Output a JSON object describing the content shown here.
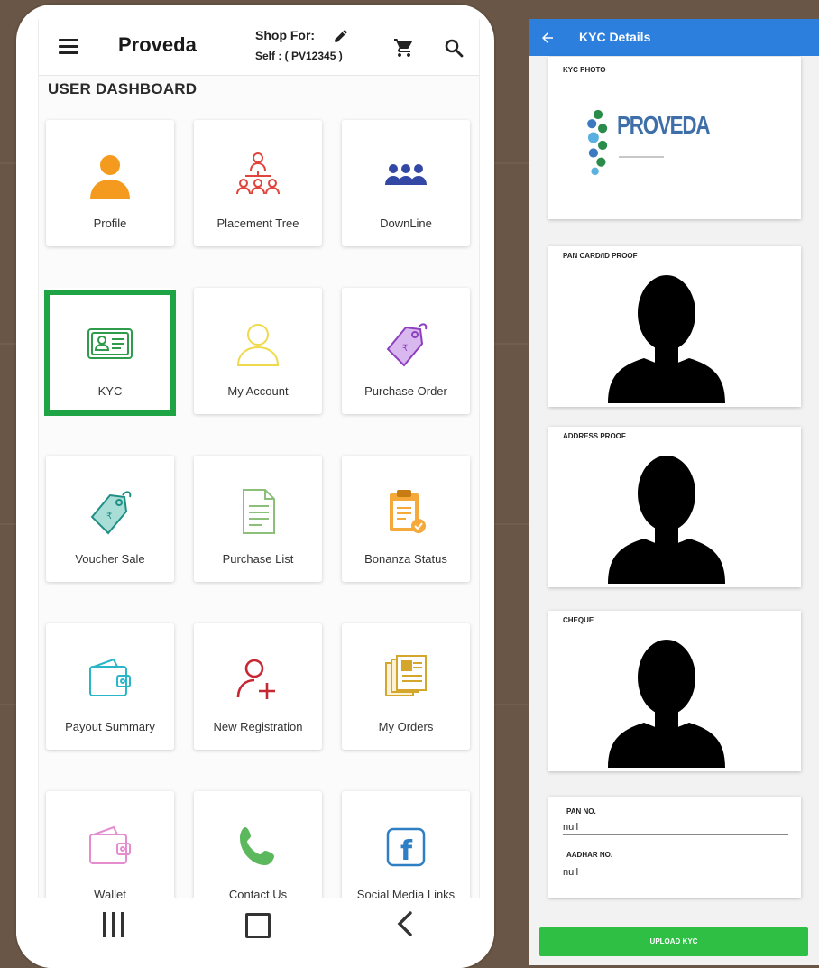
{
  "dashboard": {
    "app_name": "Proveda",
    "shop_for_label": "Shop For:",
    "shop_for_user": "Self : ( PV12345 )",
    "section_title": "USER DASHBOARD",
    "tiles": [
      {
        "label": "Profile",
        "icon": "profile-icon"
      },
      {
        "label": "Placement Tree",
        "icon": "placement-tree-icon"
      },
      {
        "label": "DownLine",
        "icon": "downline-icon"
      },
      {
        "label": "KYC",
        "icon": "kyc-card-icon",
        "selected": true
      },
      {
        "label": "My Account",
        "icon": "account-icon"
      },
      {
        "label": "Purchase Order",
        "icon": "price-tag-icon"
      },
      {
        "label": "Voucher Sale",
        "icon": "voucher-tag-icon"
      },
      {
        "label": "Purchase List",
        "icon": "document-list-icon"
      },
      {
        "label": "Bonanza Status",
        "icon": "clipboard-check-icon"
      },
      {
        "label": "Payout Summary",
        "icon": "wallet-icon"
      },
      {
        "label": "New Registration",
        "icon": "add-user-icon"
      },
      {
        "label": "My Orders",
        "icon": "orders-icon"
      },
      {
        "label": "Wallet",
        "icon": "wallet-icon"
      },
      {
        "label": "Contact Us",
        "icon": "phone-icon"
      },
      {
        "label": "Social Media Links",
        "icon": "facebook-icon"
      }
    ],
    "colors": {
      "selected_frame": "#1ea444"
    }
  },
  "kyc": {
    "title": "KYC Details",
    "photo_label": "KYC PHOTO",
    "logo_text": "PROVEDA",
    "pan_proof_label": "PAN CARD/ID PROOF",
    "address_proof_label": "ADDRESS PROOF",
    "cheque_label": "CHEQUE",
    "pan_no_label": "PAN NO.",
    "pan_no_value": "null",
    "aadhar_no_label": "AADHAR NO.",
    "aadhar_no_value": "null",
    "upload_label": "UPLOAD KYC",
    "colors": {
      "appbar": "#2c7fdd",
      "upload_button": "#2fbf45"
    }
  }
}
